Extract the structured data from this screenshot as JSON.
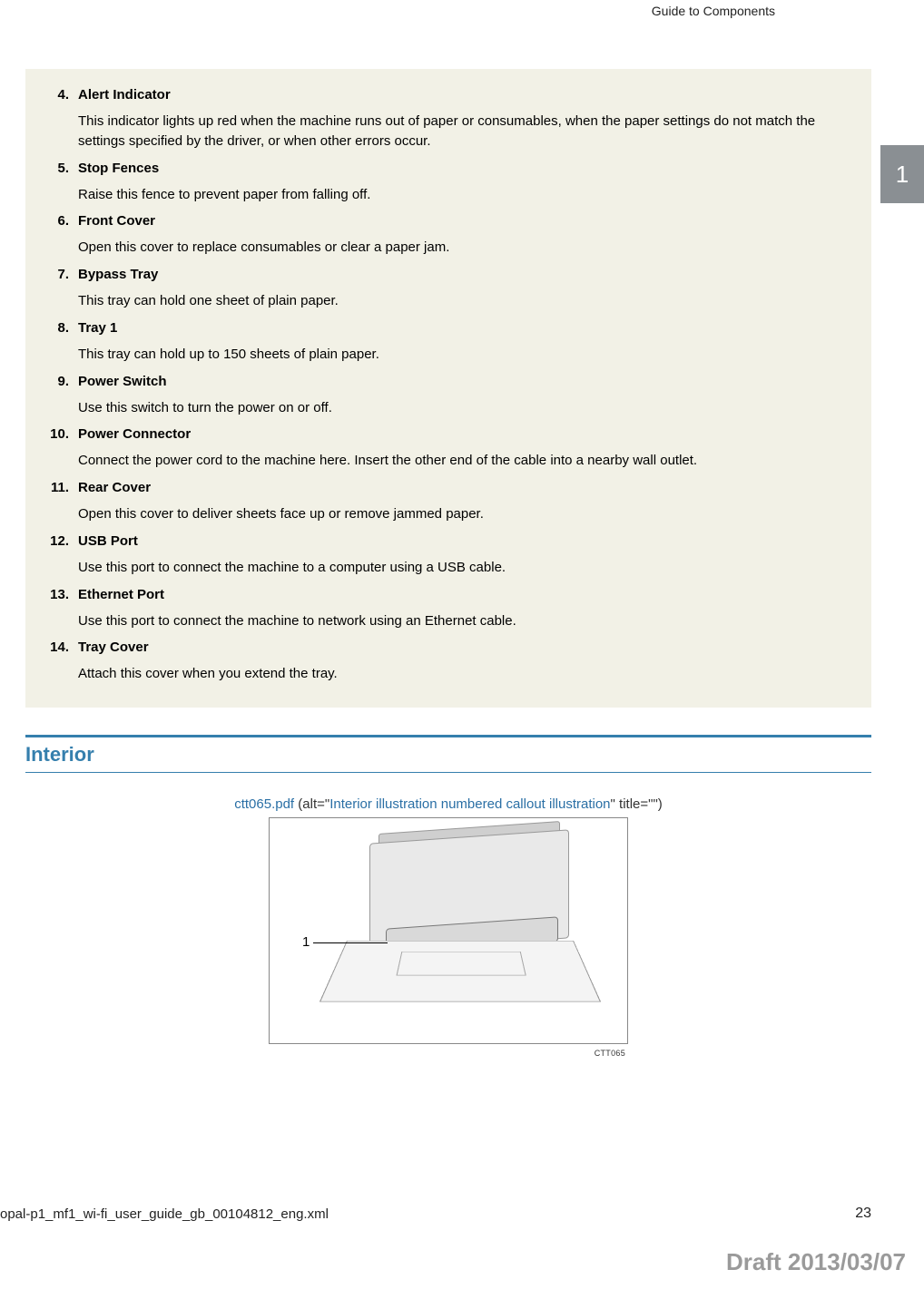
{
  "header": {
    "section_title": "Guide to Components"
  },
  "sidebar": {
    "chapter_number": "1"
  },
  "list": [
    {
      "num": "4.",
      "title": "Alert Indicator",
      "desc": "This indicator lights up red when the machine runs out of paper or consumables, when the paper settings do not match the settings specified by the driver, or when other errors occur."
    },
    {
      "num": "5.",
      "title": "Stop Fences",
      "desc": "Raise this fence to prevent paper from falling off."
    },
    {
      "num": "6.",
      "title": "Front Cover",
      "desc": "Open this cover to replace consumables or clear a paper jam."
    },
    {
      "num": "7.",
      "title": "Bypass Tray",
      "desc": "This tray can hold one sheet of plain paper."
    },
    {
      "num": "8.",
      "title": "Tray 1",
      "desc": "This tray can hold up to 150 sheets of plain paper."
    },
    {
      "num": "9.",
      "title": "Power Switch",
      "desc": "Use this switch to turn the power on or off."
    },
    {
      "num": "10.",
      "title": "Power Connector",
      "desc": "Connect the power cord to the machine here. Insert the other end of the cable into a nearby wall outlet."
    },
    {
      "num": "11.",
      "title": "Rear Cover",
      "desc": "Open this cover to deliver sheets face up or remove jammed paper."
    },
    {
      "num": "12.",
      "title": "USB Port",
      "desc": "Use this port to connect the machine to a computer using a USB cable."
    },
    {
      "num": "13.",
      "title": "Ethernet Port",
      "desc": "Use this port to connect the machine to network using an Ethernet cable."
    },
    {
      "num": "14.",
      "title": "Tray Cover",
      "desc": "Attach this cover when you extend the tray."
    }
  ],
  "section": {
    "heading": "Interior"
  },
  "figure": {
    "filename": "ctt065.pdf",
    "alt_prefix": " (alt=\"",
    "alt_text": "Interior illustration numbered callout illustration",
    "alt_suffix": "\" title=\"\")",
    "callout": "1",
    "code": "CTT065"
  },
  "footer": {
    "file": "opal-p1_mf1_wi-fi_user_guide_gb_00104812_eng.xml",
    "page": "23",
    "draft": "Draft 2013/03/07"
  }
}
